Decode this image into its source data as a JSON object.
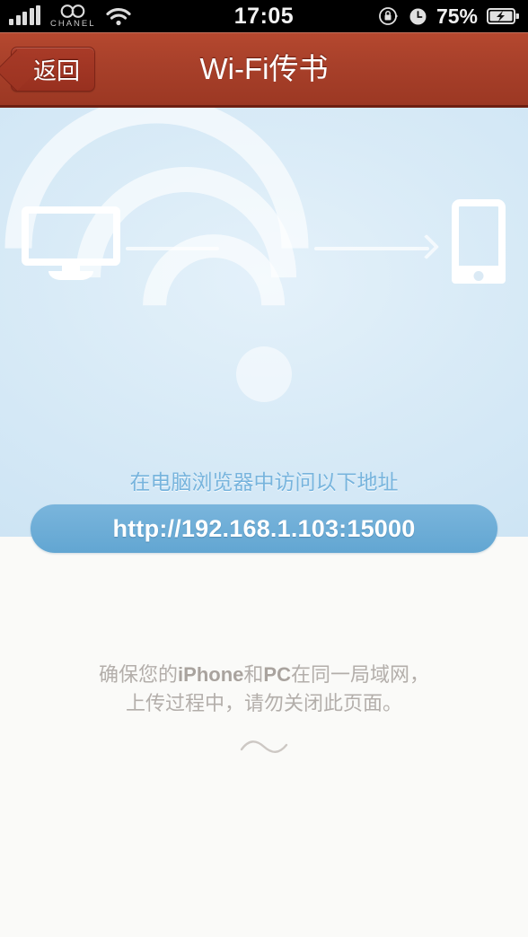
{
  "status_bar": {
    "carrier": "CHANEL",
    "carrier_logo": "chanel-cc-logo",
    "signal_icon": "signal-bars-icon",
    "signal_bars": 5,
    "wifi_icon": "wifi-icon",
    "time": "17:05",
    "rotation_lock_icon": "rotation-lock-icon",
    "alarm_icon": "alarm-clock-icon",
    "battery_percent": "75%",
    "battery_icon": "battery-charging-icon"
  },
  "navbar": {
    "back_label": "返回",
    "back_icon": "back-chevron-icon",
    "title": "Wi-Fi传书"
  },
  "hero": {
    "illustration": {
      "wifi_icon": "wifi-waves-icon",
      "monitor_icon": "desktop-monitor-icon",
      "device_icon": "smartphone-icon",
      "arrow_left_icon": "arrow-right-icon",
      "arrow_right_icon": "arrow-right-icon"
    },
    "hint": "在电脑浏览器中访问以下地址",
    "url": "http://192.168.1.103:15000"
  },
  "footer": {
    "note_line1_prefix": "确保您的",
    "note_line1_bold1": "iPhone",
    "note_line1_mid": "和",
    "note_line1_bold2": "PC",
    "note_line1_suffix": "在同一局域网，",
    "note_line2": "上传过程中，请勿关闭此页面。",
    "flourish_icon": "wave-flourish-icon"
  },
  "colors": {
    "navbar_red": "#a8402a",
    "navbar_border": "#6d1f12",
    "hero_blue": "#d9ebf7",
    "url_pill_blue": "#6aaad5",
    "hint_blue": "#77b4dd",
    "page_cream": "#fafaf8",
    "note_gray": "#b3aeaa"
  }
}
